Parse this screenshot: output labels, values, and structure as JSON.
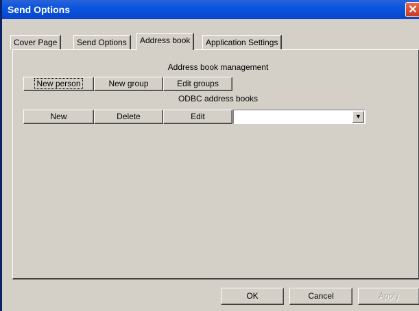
{
  "window": {
    "title": "Send Options",
    "close_glyph": "✕"
  },
  "tabs": [
    {
      "label": "Cover Page",
      "active": false
    },
    {
      "label": "Send Options",
      "active": false
    },
    {
      "label": "Address book",
      "active": true
    },
    {
      "label": "Application Settings",
      "active": false
    }
  ],
  "address_book": {
    "management_label": "Address book management",
    "new_person": "New person",
    "new_group": "New group",
    "edit_groups": "Edit groups",
    "odbc_label": "ODBC address books",
    "odbc_new": "New",
    "odbc_delete": "Delete",
    "odbc_edit": "Edit",
    "odbc_select_value": "",
    "dropdown_glyph": "▼"
  },
  "footer": {
    "ok": "OK",
    "cancel": "Cancel",
    "apply": "Apply"
  },
  "colors": {
    "titlebar": "#0a55e0",
    "face": "#d4d0c8",
    "close": "#c33a20"
  }
}
